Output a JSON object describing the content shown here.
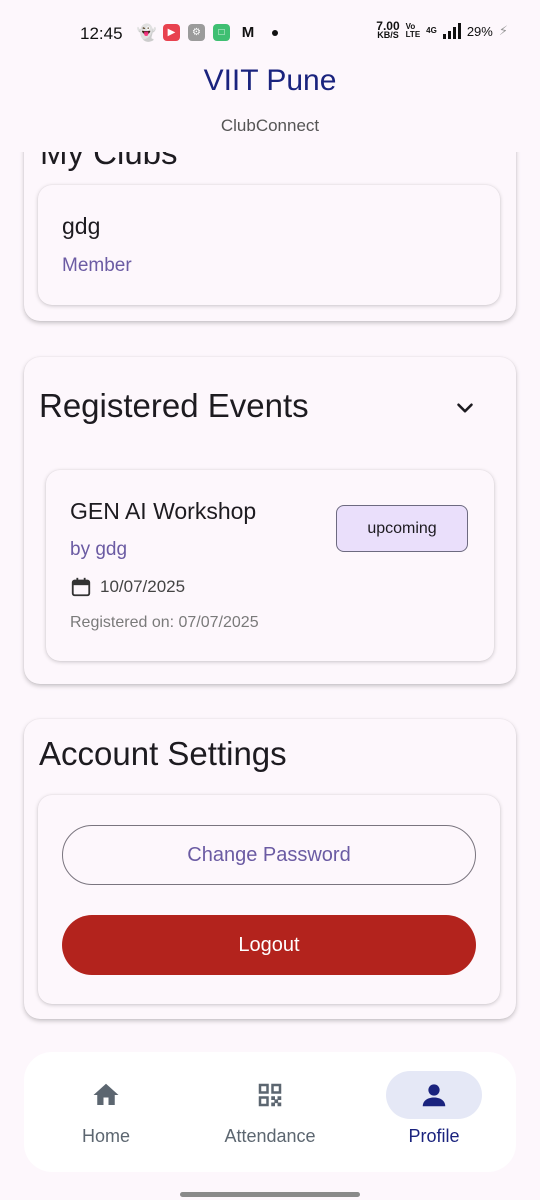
{
  "status_bar": {
    "time": "12:45",
    "net_speed_value": "7.00",
    "net_speed_unit": "KB/S",
    "volte_top": "Vo",
    "volte_bottom": "LTE",
    "network_type": "4G",
    "battery": "29%"
  },
  "header": {
    "title": "VIIT Pune",
    "subtitle": "ClubConnect"
  },
  "my_clubs": {
    "heading": "My Clubs",
    "items": [
      {
        "name": "gdg",
        "role": "Member"
      }
    ]
  },
  "registered_events": {
    "heading": "Registered Events",
    "items": [
      {
        "title": "GEN AI Workshop",
        "by": "by gdg",
        "date": "10/07/2025",
        "registered_on": "Registered on: 07/07/2025",
        "status": "upcoming"
      }
    ]
  },
  "account_settings": {
    "heading": "Account Settings",
    "change_password_label": "Change Password",
    "logout_label": "Logout"
  },
  "bottom_nav": {
    "items": [
      {
        "label": "Home",
        "icon": "home-icon"
      },
      {
        "label": "Attendance",
        "icon": "qr-code-icon"
      },
      {
        "label": "Profile",
        "icon": "person-icon"
      }
    ],
    "active": "Profile"
  },
  "colors": {
    "title": "#1a237e",
    "accent_purple": "#6b5ba3",
    "logout_red": "#b3231d",
    "chip_bg": "#eadffb",
    "background": "#fdf7fc"
  }
}
